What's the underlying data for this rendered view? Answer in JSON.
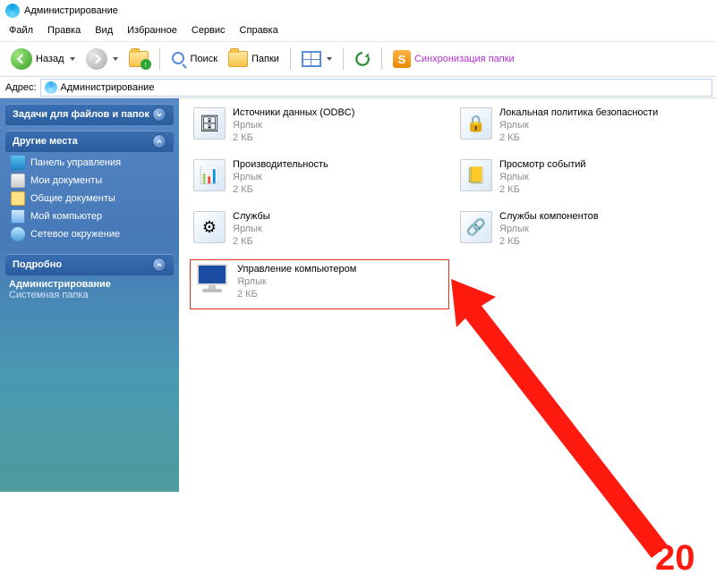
{
  "window": {
    "title": "Администрирование"
  },
  "menubar": [
    "Файл",
    "Правка",
    "Вид",
    "Избранное",
    "Сервис",
    "Справка"
  ],
  "toolbar": {
    "back": "Назад",
    "search": "Поиск",
    "folders": "Папки",
    "sync": "Синхронизация папки"
  },
  "address": {
    "label": "Адрес:",
    "value": "Администрирование"
  },
  "sidebar": {
    "panel1": {
      "title": "Задачи для файлов и папок"
    },
    "panel2": {
      "title": "Другие места",
      "items": [
        {
          "label": "Панель управления",
          "iconCls": "cpanel"
        },
        {
          "label": "Мои документы",
          "iconCls": "docs"
        },
        {
          "label": "Общие документы",
          "iconCls": "shared"
        },
        {
          "label": "Мой компьютер",
          "iconCls": "pc"
        },
        {
          "label": "Сетевое окружение",
          "iconCls": "net"
        }
      ]
    },
    "panel3": {
      "title": "Подробно",
      "name": "Администрирование",
      "kind": "Системная папка"
    }
  },
  "files": [
    {
      "name": "Источники данных (ODBC)",
      "type": "Ярлык",
      "size": "2 КБ",
      "glyph": "🗄"
    },
    {
      "name": "Локальная политика безопасности",
      "type": "Ярлык",
      "size": "2 КБ",
      "glyph": "🔒"
    },
    {
      "name": "Производительность",
      "type": "Ярлык",
      "size": "2 КБ",
      "glyph": "📊"
    },
    {
      "name": "Просмотр событий",
      "type": "Ярлык",
      "size": "2 КБ",
      "glyph": "📒"
    },
    {
      "name": "Службы",
      "type": "Ярлык",
      "size": "2 КБ",
      "glyph": "⚙"
    },
    {
      "name": "Службы компонентов",
      "type": "Ярлык",
      "size": "2 КБ",
      "glyph": "🔗"
    },
    {
      "name": "Управление компьютером",
      "type": "Ярлык",
      "size": "2 КБ",
      "highlight": true
    }
  ],
  "annotation": {
    "number": "20"
  }
}
